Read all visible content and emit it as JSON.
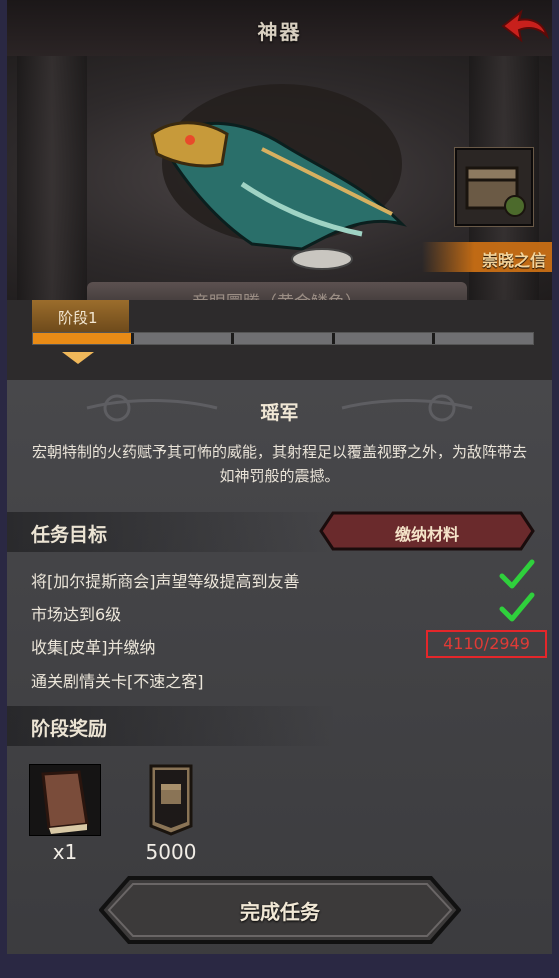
{
  "header": {
    "title": "神器",
    "back_icon": "back-arrow-icon"
  },
  "hero": {
    "artifact_icon": "dragon-cannon-artifact-icon",
    "chest_icon": "treasure-chest-icon",
    "belief_label": "崇晓之信",
    "name_partial": "帝眼圜腾（黄金鳞鱼）"
  },
  "stage": {
    "tab_label": "阶段1",
    "progress": {
      "completed_segments": 1,
      "total_segments": 5
    }
  },
  "item": {
    "name": "瑶军",
    "description": "宏朝特制的火药赋予其可怖的威能，其射程足以覆盖视野之外，为敌阵带去如神罚般的震撼。"
  },
  "tasks": {
    "heading": "任务目标",
    "submit_label": "缴纳材料",
    "items": [
      {
        "text": "将[加尔提斯商会]声望等级提高到友善",
        "done": true
      },
      {
        "text": "市场达到6级",
        "done": true
      },
      {
        "text": "收集[皮革]并缴纳",
        "progress": "4110/2949"
      },
      {
        "text": "通关剧情关卡[不速之客]"
      }
    ]
  },
  "rewards": {
    "heading": "阶段奖励",
    "items": [
      {
        "icon": "book-icon",
        "qty": "x1"
      },
      {
        "icon": "chest-banner-icon",
        "qty": "5000"
      }
    ]
  },
  "complete_label": "完成任务",
  "colors": {
    "accent": "#e98b16",
    "check": "#2fd03c",
    "warning": "#e4262a"
  }
}
